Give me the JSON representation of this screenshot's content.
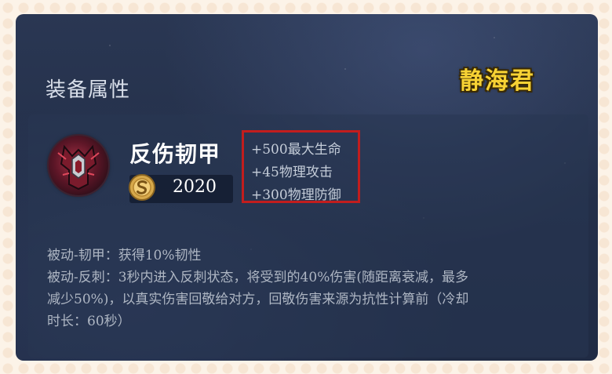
{
  "section_title": "装备属性",
  "watermark": "静海君",
  "item": {
    "name": "反伤韧甲",
    "price": "2020",
    "icon": "armor-icon",
    "stats": [
      "+500最大生命",
      "+45物理攻击",
      "+300物理防御"
    ],
    "descriptions": [
      "被动-韧甲：获得10%韧性",
      "被动-反刺：3秒内进入反刺状态，将受到的40%伤害(随距离衰减，最多",
      "减少50%)，以真实伤害回敬给对方，回敬伤害来源为抗性计算前（冷却",
      "时长：60秒）"
    ]
  },
  "colors": {
    "highlight_border": "#c21d1d",
    "watermark": "#f7d234",
    "panel_bg": "#24304a"
  }
}
